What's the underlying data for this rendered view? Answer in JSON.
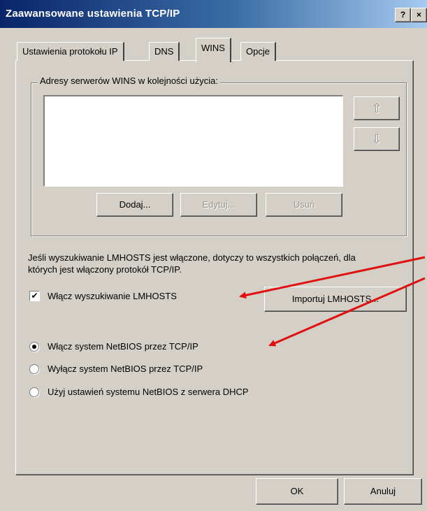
{
  "window": {
    "title": "Zaawansowane ustawienia TCP/IP",
    "help_label": "?",
    "close_label": "×"
  },
  "tabs": [
    {
      "label": "Ustawienia protokołu IP",
      "active": false
    },
    {
      "label": "DNS",
      "active": false
    },
    {
      "label": "WINS",
      "active": true
    },
    {
      "label": "Opcje",
      "active": false
    }
  ],
  "wins_group": {
    "label": "Adresy serwerów WINS w kolejności użycia:",
    "up_arrow": "⇧",
    "down_arrow": "⇩",
    "add_label": "Dodaj...",
    "edit_label": "Edytuj...",
    "remove_label": "Usuń"
  },
  "info_text": "Jeśli wyszukiwanie LMHOSTS jest włączone, dotyczy to wszystkich połączeń, dla których jest włączony protokół TCP/IP.",
  "lmhosts": {
    "checkbox_label": "Włącz wyszukiwanie LMHOSTS",
    "checked": true,
    "import_label": "Importuj LMHOSTS..."
  },
  "netbios_options": [
    {
      "label": "Włącz system NetBIOS przez TCP/IP",
      "selected": true
    },
    {
      "label": "Wyłącz system NetBIOS przez TCP/IP",
      "selected": false
    },
    {
      "label": "Użyj ustawień systemu NetBIOS z serwera DHCP",
      "selected": false
    }
  ],
  "footer": {
    "ok_label": "OK",
    "cancel_label": "Anuluj"
  },
  "colors": {
    "annotation_arrow": "#e01010",
    "titlebar_start": "#0a246a",
    "dialog_bg": "#d4d0c8"
  }
}
